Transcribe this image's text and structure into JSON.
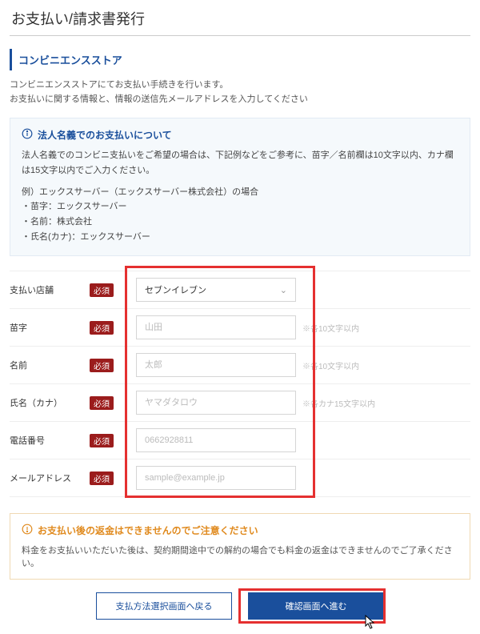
{
  "page": {
    "title": "お支払い/請求書発行"
  },
  "section": {
    "heading": "コンビニエンスストア",
    "intro1": "コンビニエンスストアにてお支払い手続きを行います。",
    "intro2": "お支払いに関する情報と、情報の送信先メールアドレスを入力してください"
  },
  "notice": {
    "title": "法人名義でのお支払いについて",
    "body": "法人名義でのコンビニ支払いをご希望の場合は、下記例などをご参考に、苗字／名前欄は10文字以内、カナ欄は15文字以内でご入力ください。",
    "example_label": "例）エックスサーバー（エックスサーバー株式会社）の場合",
    "ex1": "・苗字：エックスサーバー",
    "ex2": "・名前：株式会社",
    "ex3": "・氏名(カナ)：エックスサーバー"
  },
  "form": {
    "required_badge": "必須",
    "store": {
      "label": "支払い店舗",
      "value": "セブンイレブン"
    },
    "lastname": {
      "label": "苗字",
      "placeholder": "山田",
      "hint": "※各10文字以内"
    },
    "firstname": {
      "label": "名前",
      "placeholder": "太郎",
      "hint": "※各10文字以内"
    },
    "kana": {
      "label": "氏名（カナ）",
      "placeholder": "ヤマダタロウ",
      "hint": "※各カナ15文字以内"
    },
    "phone": {
      "label": "電話番号",
      "placeholder": "0662928811"
    },
    "email": {
      "label": "メールアドレス",
      "placeholder": "sample@example.jp"
    }
  },
  "warning": {
    "title": "お支払い後の返金はできませんのでご注意ください",
    "body": "料金をお支払いいただいた後は、契約期間途中での解約の場合でも料金の返金はできませんのでご了承ください。"
  },
  "buttons": {
    "back": "支払方法選択画面へ戻る",
    "confirm": "確認画面へ進む"
  }
}
